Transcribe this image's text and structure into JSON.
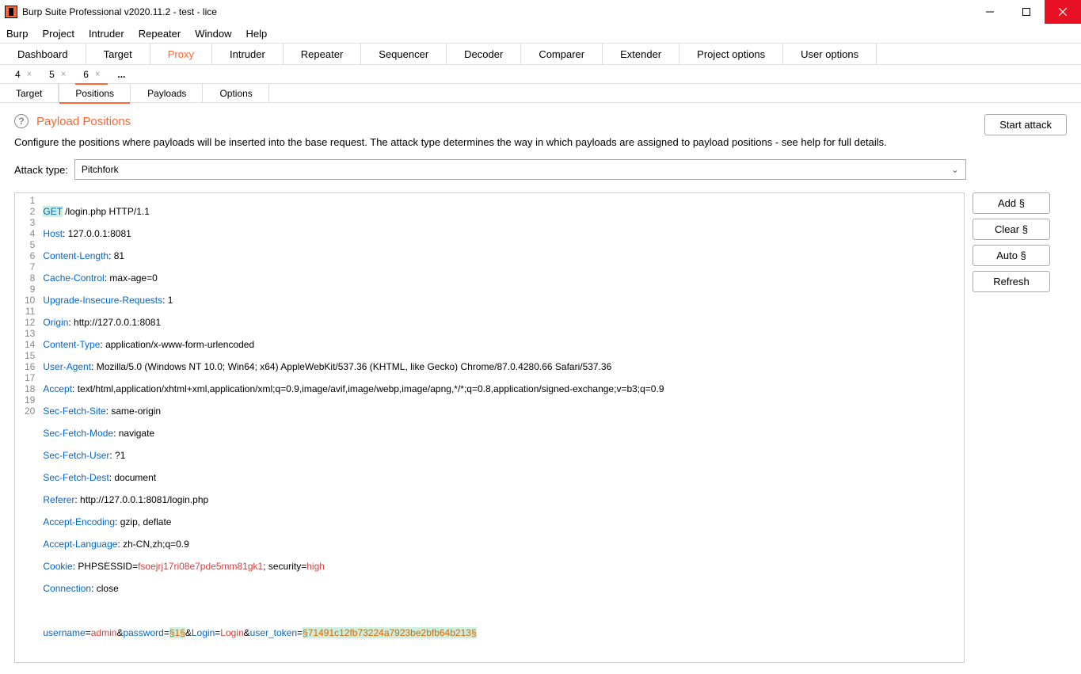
{
  "window": {
    "title": "Burp Suite Professional v2020.11.2 - test - lice"
  },
  "menu": [
    "Burp",
    "Project",
    "Intruder",
    "Repeater",
    "Window",
    "Help"
  ],
  "main_tabs": [
    {
      "label": "Dashboard"
    },
    {
      "label": "Target"
    },
    {
      "label": "Proxy",
      "active": true
    },
    {
      "label": "Intruder"
    },
    {
      "label": "Repeater"
    },
    {
      "label": "Sequencer"
    },
    {
      "label": "Decoder"
    },
    {
      "label": "Comparer"
    },
    {
      "label": "Extender"
    },
    {
      "label": "Project options"
    },
    {
      "label": "User options"
    }
  ],
  "num_tabs": [
    {
      "label": "4"
    },
    {
      "label": "5"
    },
    {
      "label": "6",
      "active": true
    }
  ],
  "ellipsis": "...",
  "intruder_tabs": [
    {
      "label": "Target"
    },
    {
      "label": "Positions",
      "active": true
    },
    {
      "label": "Payloads"
    },
    {
      "label": "Options"
    }
  ],
  "section_title": "Payload Positions",
  "start_attack": "Start attack",
  "description": "Configure the positions where payloads will be inserted into the base request. The attack type determines the way in which payloads are assigned to payload positions - see help for full details.",
  "attack_label": "Attack type:",
  "attack_value": "Pitchfork",
  "side_buttons": [
    "Add §",
    "Clear §",
    "Auto §",
    "Refresh"
  ],
  "request": {
    "line1_method": "GET",
    "line1_rest": " /login.php HTTP/1.1",
    "l2k": "Host",
    "l2v": ": 127.0.0.1:8081",
    "l3k": "Content-Length",
    "l3v": ": 81",
    "l4k": "Cache-Control",
    "l4v": ": max-age=0",
    "l5k": "Upgrade-Insecure-Requests",
    "l5v": ": 1",
    "l6k": "Origin",
    "l6v": ": http://127.0.0.1:8081",
    "l7k": "Content-Type",
    "l7v": ": application/x-www-form-urlencoded",
    "l8k": "User-Agent",
    "l8v": ": Mozilla/5.0 (Windows NT 10.0; Win64; x64) AppleWebKit/537.36 (KHTML, like Gecko) Chrome/87.0.4280.66 Safari/537.36",
    "l9k": "Accept",
    "l9v": ": text/html,application/xhtml+xml,application/xml;q=0.9,image/avif,image/webp,image/apng,*/*;q=0.8,application/signed-exchange;v=b3;q=0.9",
    "l10k": "Sec-Fetch-Site",
    "l10v": ": same-origin",
    "l11k": "Sec-Fetch-Mode",
    "l11v": ": navigate",
    "l12k": "Sec-Fetch-User",
    "l12v": ": ?1",
    "l13k": "Sec-Fetch-Dest",
    "l13v": ": document",
    "l14k": "Referer",
    "l14v": ": http://127.0.0.1:8081/login.php",
    "l15k": "Accept-Encoding",
    "l15v": ": gzip, deflate",
    "l16k": "Accept-Language",
    "l16v": ": zh-CN,zh;q=0.9",
    "l17k": "Cookie",
    "l17a": ": PHPSESSID=",
    "l17b": "fsoejrj17ri08e7pde5mm81gk1",
    "l17c": "; security=",
    "l17d": "high",
    "l18k": "Connection",
    "l18v": ": close",
    "l20a": "username",
    "l20b": "=",
    "l20c": "admin",
    "l20d": "&",
    "l20e": "password",
    "l20f": "=",
    "l20m1": "§1§",
    "l20g": "&",
    "l20h": "Login",
    "l20i": "=",
    "l20j": "Login",
    "l20k": "&",
    "l20l": "user_token",
    "l20m": "=",
    "l20m2": "§71491c12fb73224a7923be2bfb64b213§"
  },
  "line_numbers": [
    "1",
    "2",
    "3",
    "4",
    "5",
    "6",
    "7",
    "8",
    "9",
    "10",
    "11",
    "12",
    "13",
    "14",
    "15",
    "16",
    "17",
    "18",
    "19",
    "20"
  ]
}
